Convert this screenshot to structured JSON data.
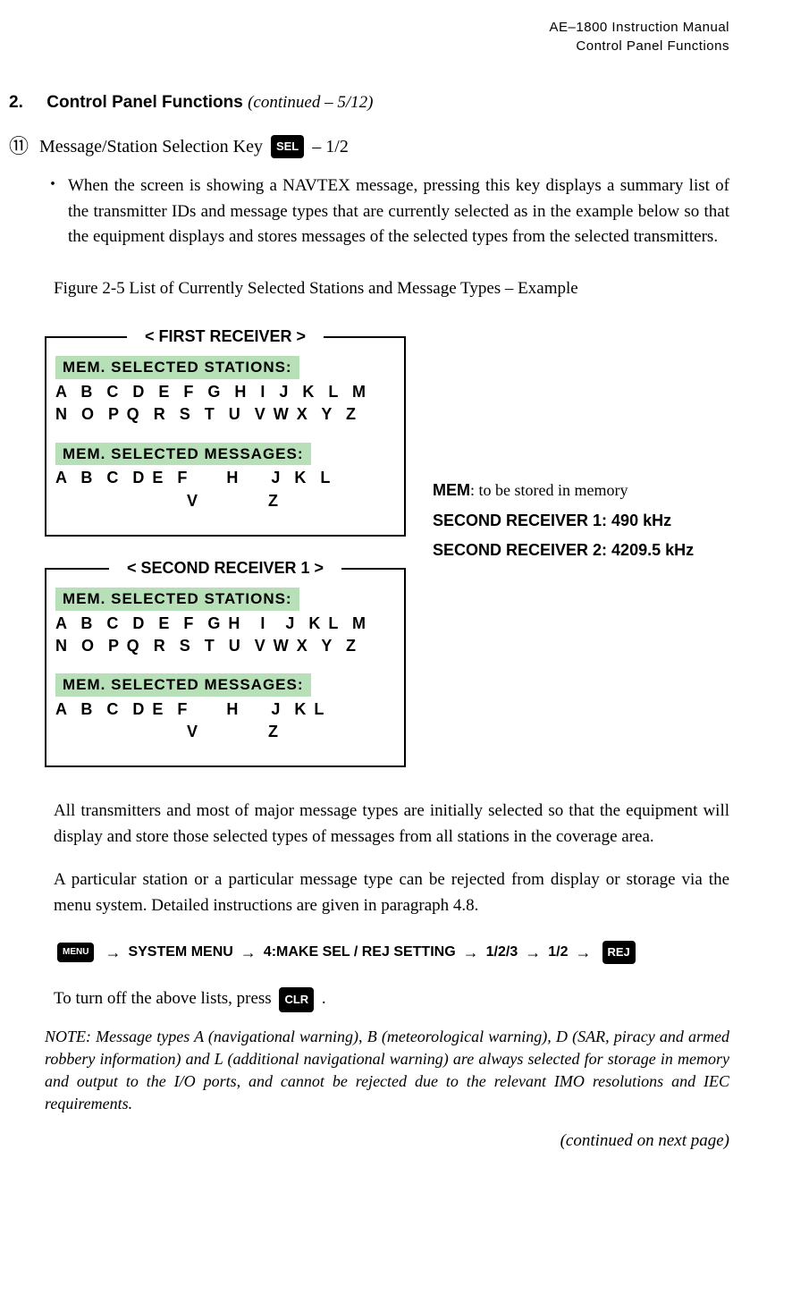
{
  "header": {
    "line1": "AE–1800 Instruction Manual",
    "line2": "Control Panel Functions"
  },
  "section": {
    "number": "2.",
    "title": "Control Panel Functions",
    "continued": "(continued – 5/12)"
  },
  "item": {
    "number": "⑪",
    "label": "Message/Station Selection Key",
    "key": "SEL",
    "suffix": "– 1/2"
  },
  "para1": "When the screen is showing a NAVTEX message, pressing this key displays a summary list of the transmitter IDs and message types that are currently selected as in the example below so that the equipment displays and stores messages of the selected types from the selected transmitters.",
  "figureCaption": "Figure 2-5   List of Currently Selected Stations and Message Types – Example",
  "receiver1": {
    "legend": "< FIRST RECEIVER >",
    "stationsHeader": "MEM. SELECTED STATIONS:",
    "stationsLine1": "A  B  C  D  E  F  G  H  I  J  K  L  M",
    "stationsLine2": "N  O  P Q  R  S  T  U  V W X  Y  Z",
    "messagesHeader": "MEM. SELECTED MESSAGES:",
    "messagesLine1": "A  B  C  D E  F      H     J  K  L",
    "messagesLine2": "                     V           Z"
  },
  "receiver2": {
    "legend": "< SECOND RECEIVER 1 >",
    "stationsHeader": "MEM. SELECTED STATIONS:",
    "stationsLine1": "A  B  C  D  E  F  G H   I   J  K L  M",
    "stationsLine2": "N  O  P Q  R  S  T  U  V W X  Y  Z",
    "messagesHeader": "MEM. SELECTED MESSAGES:",
    "messagesLine1": "A  B  C  D E  F      H     J  K L",
    "messagesLine2": "                     V           Z"
  },
  "sideNotes": {
    "memLabel": "MEM",
    "memText": ": to be stored in memory",
    "sr1Label": "SECOND RECEIVER 1",
    "sr1Text": ": 490 kHz",
    "sr2Label": "SECOND RECEIVER 2",
    "sr2Text": ": 4209.5 kHz"
  },
  "para2": "All transmitters and most of major message types are initially selected so that the equipment will display and store those selected types of messages from all stations in the coverage area.",
  "para3": "A particular station or a particular message type can be rejected from display or storage via the menu system. Detailed instructions are given in paragraph 4.8.",
  "navPath": {
    "menuKey": "MENU",
    "step1": "SYSTEM MENU",
    "step2": "4:MAKE SEL / REJ SETTING",
    "step3": "1/2/3",
    "step4": "1/2",
    "rejKey": "REJ"
  },
  "para4Prefix": "To turn off the above lists, press",
  "clrKey": "CLR",
  "para4Suffix": ".",
  "note": "NOTE: Message types A (navigational warning), B (meteorological warning), D (SAR, piracy and armed robbery information) and L (additional navigational warning) are always selected for storage in memory and output to the I/O ports, and cannot be rejected due to the relevant IMO resolutions and IEC requirements.",
  "footer": "(continued on next page)"
}
